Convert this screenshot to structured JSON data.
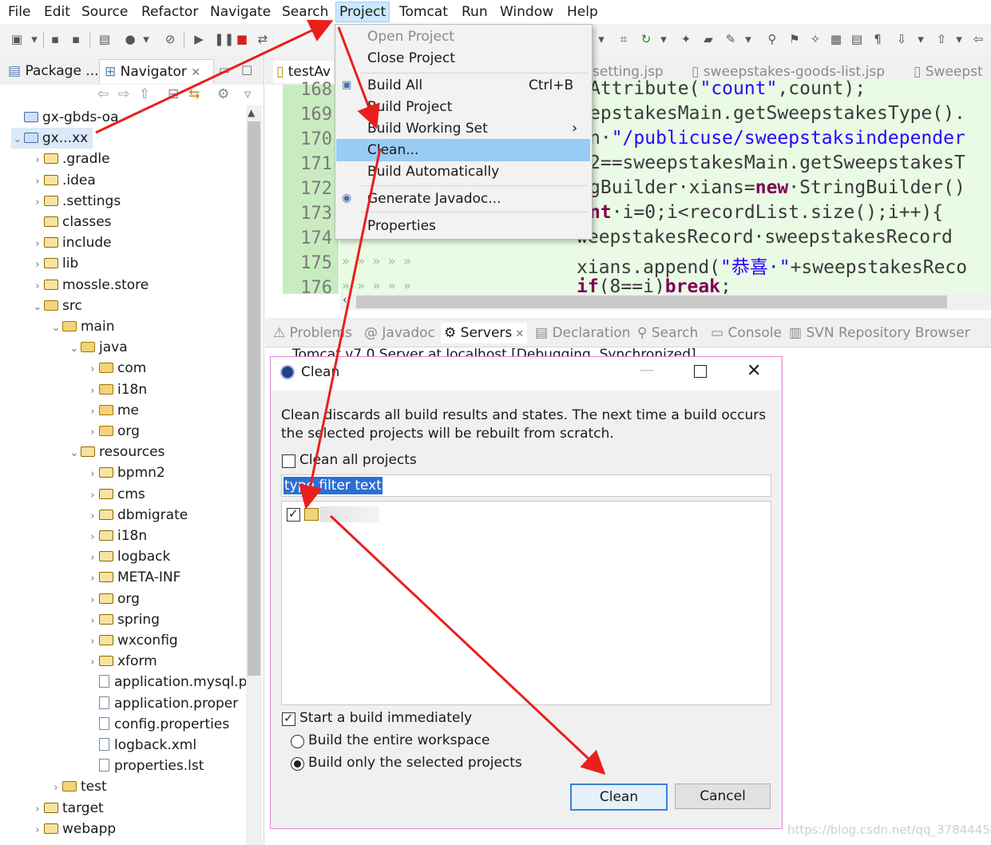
{
  "menubar": {
    "items": [
      "File",
      "Edit",
      "Source",
      "Refactor",
      "Navigate",
      "Search",
      "Project",
      "Tomcat",
      "Run",
      "Window",
      "Help"
    ],
    "active": "Project"
  },
  "left_panel": {
    "tab_package": "Package ...",
    "tab_navigator": "Navigator",
    "tree": [
      {
        "label": "gx-gbds-oa",
        "indent": 0,
        "twisty": "",
        "type": "project"
      },
      {
        "label": "gx...xx",
        "indent": 0,
        "twisty": "v",
        "type": "project"
      },
      {
        "label": ".gradle",
        "indent": 1,
        "twisty": ">",
        "type": "folder"
      },
      {
        "label": ".idea",
        "indent": 1,
        "twisty": ">",
        "type": "folder"
      },
      {
        "label": ".settings",
        "indent": 1,
        "twisty": ">",
        "type": "folder"
      },
      {
        "label": "classes",
        "indent": 1,
        "twisty": "",
        "type": "folder"
      },
      {
        "label": "include",
        "indent": 1,
        "twisty": ">",
        "type": "folder"
      },
      {
        "label": "lib",
        "indent": 1,
        "twisty": ">",
        "type": "folder"
      },
      {
        "label": "mossle.store",
        "indent": 1,
        "twisty": ">",
        "type": "folder"
      },
      {
        "label": "src",
        "indent": 1,
        "twisty": "v",
        "type": "pkg"
      },
      {
        "label": "main",
        "indent": 2,
        "twisty": "v",
        "type": "pkg"
      },
      {
        "label": "java",
        "indent": 3,
        "twisty": "v",
        "type": "pkg"
      },
      {
        "label": "com",
        "indent": 4,
        "twisty": ">",
        "type": "pkg"
      },
      {
        "label": "i18n",
        "indent": 4,
        "twisty": ">",
        "type": "pkg"
      },
      {
        "label": "me",
        "indent": 4,
        "twisty": ">",
        "type": "pkg"
      },
      {
        "label": "org",
        "indent": 4,
        "twisty": ">",
        "type": "pkg"
      },
      {
        "label": "resources",
        "indent": 3,
        "twisty": "v",
        "type": "folder"
      },
      {
        "label": "bpmn2",
        "indent": 4,
        "twisty": ">",
        "type": "folder"
      },
      {
        "label": "cms",
        "indent": 4,
        "twisty": ">",
        "type": "folder"
      },
      {
        "label": "dbmigrate",
        "indent": 4,
        "twisty": ">",
        "type": "folder"
      },
      {
        "label": "i18n",
        "indent": 4,
        "twisty": ">",
        "type": "folder"
      },
      {
        "label": "logback",
        "indent": 4,
        "twisty": ">",
        "type": "folder"
      },
      {
        "label": "META-INF",
        "indent": 4,
        "twisty": ">",
        "type": "folder"
      },
      {
        "label": "org",
        "indent": 4,
        "twisty": ">",
        "type": "folder"
      },
      {
        "label": "spring",
        "indent": 4,
        "twisty": ">",
        "type": "folder"
      },
      {
        "label": "wxconfig",
        "indent": 4,
        "twisty": ">",
        "type": "folder"
      },
      {
        "label": "xform",
        "indent": 4,
        "twisty": ">",
        "type": "folder"
      },
      {
        "label": "application.mysql.p",
        "indent": 4,
        "twisty": "",
        "type": "file"
      },
      {
        "label": "application.proper",
        "indent": 4,
        "twisty": "",
        "type": "file"
      },
      {
        "label": "config.properties",
        "indent": 4,
        "twisty": "",
        "type": "file"
      },
      {
        "label": "logback.xml",
        "indent": 4,
        "twisty": "",
        "type": "file"
      },
      {
        "label": "properties.lst",
        "indent": 4,
        "twisty": "",
        "type": "file"
      },
      {
        "label": "test",
        "indent": 2,
        "twisty": ">",
        "type": "pkg"
      },
      {
        "label": "target",
        "indent": 1,
        "twisty": ">",
        "type": "folder"
      },
      {
        "label": "webapp",
        "indent": 1,
        "twisty": ">",
        "type": "folder"
      }
    ]
  },
  "editor": {
    "tabs": [
      "testAv",
      "setting.jsp",
      "sweepstakes-goods-list.jsp",
      "Sweepst"
    ],
    "lines": [
      {
        "n": "168",
        "parts": [
          {
            "t": "Attribute(",
            "c": "#3a3a3a"
          },
          {
            "t": "\"count\"",
            "c": "#2a00ff"
          },
          {
            "t": ",count);",
            "c": "#3a3a3a"
          }
        ]
      },
      {
        "n": "169",
        "parts": [
          {
            "t": "epstakesMain.getSweepstakesType().",
            "c": "#3a3a3a"
          }
        ]
      },
      {
        "n": "170",
        "parts": [
          {
            "t": "n·",
            "c": "#3a3a3a"
          },
          {
            "t": "\"/publicuse/sweepstaksindepender",
            "c": "#2a00ff"
          }
        ]
      },
      {
        "n": "171",
        "parts": [
          {
            "t": "2==sweepstakesMain.getSweepstakesT",
            "c": "#3a3a3a"
          }
        ]
      },
      {
        "n": "172",
        "parts": [
          {
            "t": "gBuilder·xians=",
            "c": "#3a3a3a"
          },
          {
            "t": "new",
            "c": "#7f0055"
          },
          {
            "t": "·StringBuilder()",
            "c": "#3a3a3a"
          }
        ]
      },
      {
        "n": "173",
        "parts": [
          {
            "t": "nt",
            "c": "#7f0055"
          },
          {
            "t": "·i=0;i<recordList.size();i++){",
            "c": "#3a3a3a"
          }
        ]
      },
      {
        "n": "174",
        "parts": [
          {
            "t": "weepstakesRecord·sweepstakesRecord",
            "c": "#3a3a3a"
          }
        ]
      },
      {
        "n": "175",
        "parts": [
          {
            "t": "xians.append(",
            "c": "#3a3a3a"
          },
          {
            "t": "\"恭喜·\"",
            "c": "#2a00ff"
          },
          {
            "t": "+sweepstakesReco",
            "c": "#3a3a3a"
          }
        ]
      },
      {
        "n": "176",
        "parts": [
          {
            "t": "if",
            "c": "#7f0055"
          },
          {
            "t": "(8==i)",
            "c": "#3a3a3a"
          },
          {
            "t": "break",
            "c": "#7f0055"
          },
          {
            "t": ";",
            "c": "#3a3a3a"
          }
        ]
      }
    ]
  },
  "bottom_tabs": [
    "Problems",
    "Javadoc",
    "Servers",
    "Declaration",
    "Search",
    "Console",
    "SVN Repository Browser"
  ],
  "bottom_selected": "Servers",
  "server_line": "Tomcat v7.0 Server at localhost [Debugging, Synchronized]",
  "project_menu": {
    "items": [
      {
        "label": "Open Project",
        "disabled": true,
        "shortcut": ""
      },
      {
        "label": "Close Project",
        "disabled": false,
        "shortcut": ""
      },
      {
        "label": "Build All",
        "disabled": false,
        "shortcut": "Ctrl+B"
      },
      {
        "label": "Build Project",
        "disabled": false,
        "shortcut": ""
      },
      {
        "label": "Build Working Set",
        "disabled": false,
        "shortcut": "›"
      },
      {
        "label": "Clean...",
        "disabled": false,
        "shortcut": ""
      },
      {
        "label": "Build Automatically",
        "disabled": false,
        "shortcut": ""
      },
      {
        "label": "Generate Javadoc...",
        "disabled": false,
        "shortcut": ""
      },
      {
        "label": "Properties",
        "disabled": false,
        "shortcut": ""
      }
    ],
    "selected": "Clean..."
  },
  "clean_dialog": {
    "title": "Clean",
    "description_line1": "Clean discards all build results and states.  The next time a build occurs",
    "description_line2": "the selected projects will be rebuilt from scratch.",
    "clean_all_label": "Clean all projects",
    "clean_all_checked": false,
    "filter_value": "type filter text",
    "start_build_label": "Start a build immediately",
    "start_build_checked": true,
    "radio_entire": "Build the entire workspace",
    "radio_selected": "Build only the selected projects",
    "radio_choice": "selected",
    "clean_button": "Clean",
    "cancel_button": "Cancel"
  },
  "watermark": "https://blog.csdn.net/qq_37844454",
  "colors": {
    "annotation_arrow": "#e8201c",
    "menu_highlight": "#99ccf5",
    "code_bg": "#e9fbe5",
    "gutter_bg": "#c8ecc0",
    "dialog_border": "#e08ad0"
  }
}
